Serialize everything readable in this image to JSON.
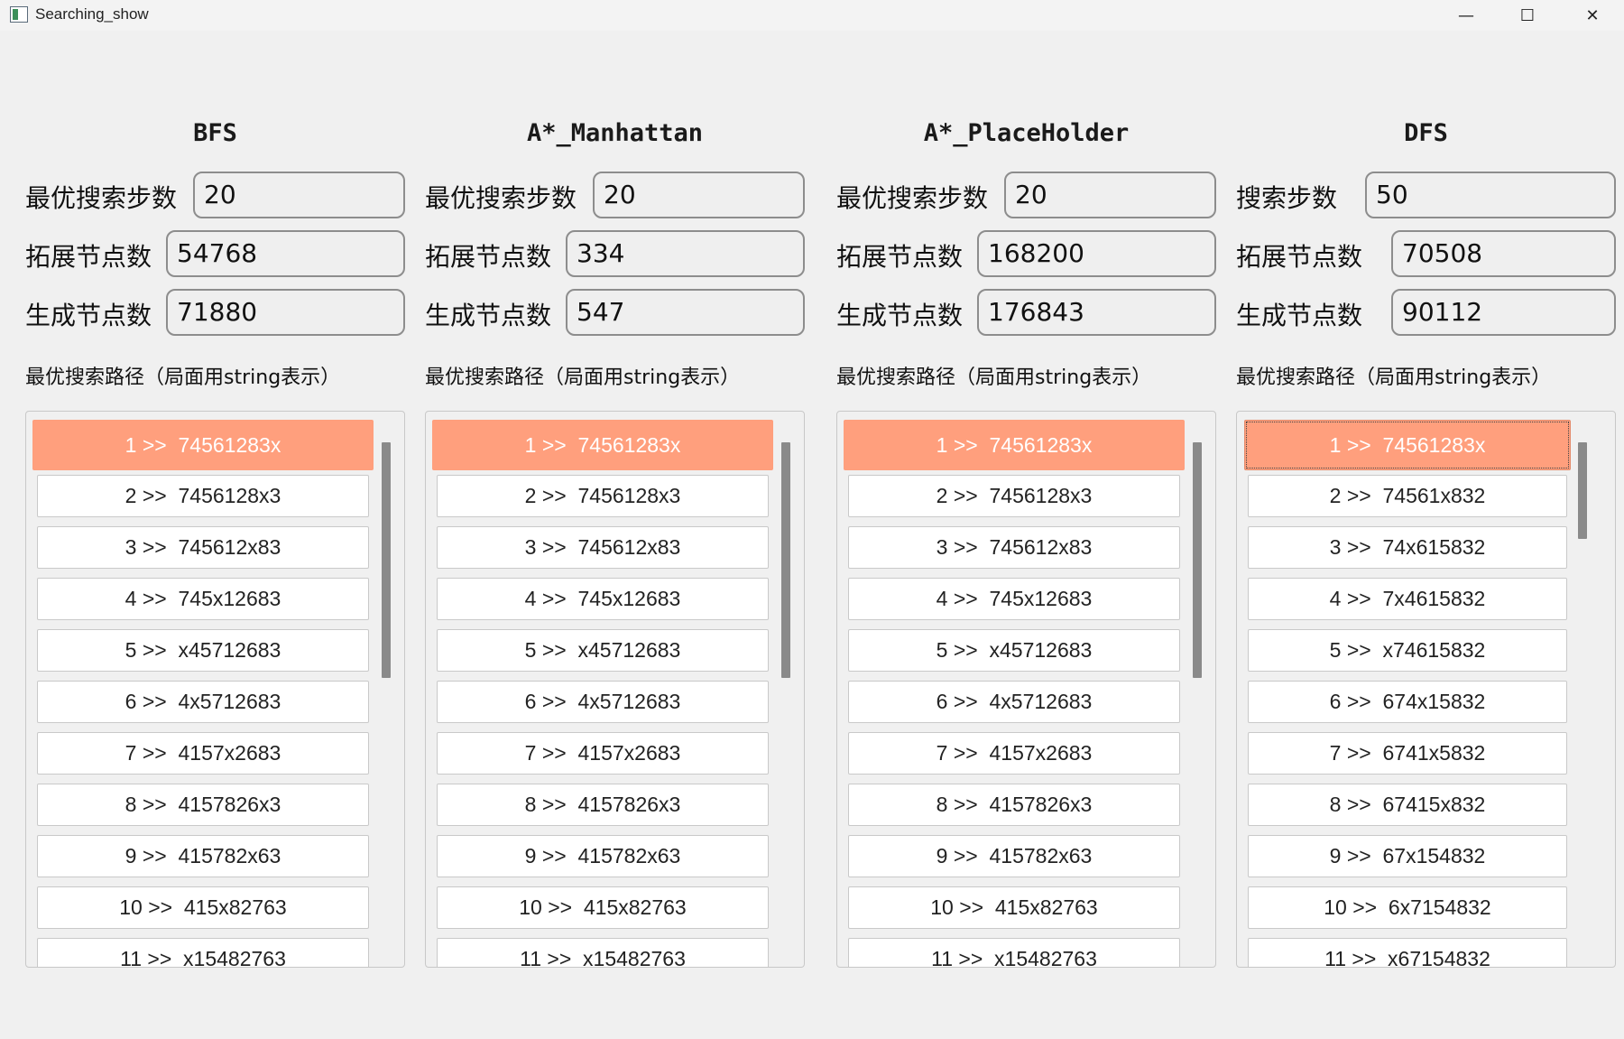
{
  "window": {
    "title": "Searching_show",
    "minimize_glyph": "—",
    "maximize_glyph": "☐",
    "close_glyph": "✕"
  },
  "path_caption": "最优搜索路径（局面用string表示）",
  "colors": {
    "selected": "#ff9f7d",
    "scrollbar": "#8a8a8a",
    "background": "#f0f0f0"
  },
  "columns": [
    {
      "title": "BFS",
      "steps_label": "最优搜索步数",
      "steps": "20",
      "expanded_label": "拓展节点数",
      "expanded": "54768",
      "generated_label": "生成节点数",
      "generated": "71880",
      "items": [
        "1 >>  74561283x",
        "2 >>  7456128x3",
        "3 >>  745612x83",
        "4 >>  745x12683",
        "5 >>  x45712683",
        "6 >>  4x5712683",
        "7 >>  4157x2683",
        "8 >>  4157826x3",
        "9 >>  415782x63",
        "10 >>  415x82763",
        "11 >>  x15482763"
      ]
    },
    {
      "title": "A*_Manhattan",
      "steps_label": "最优搜索步数",
      "steps": "20",
      "expanded_label": "拓展节点数",
      "expanded": "334",
      "generated_label": "生成节点数",
      "generated": "547",
      "items": [
        "1 >>  74561283x",
        "2 >>  7456128x3",
        "3 >>  745612x83",
        "4 >>  745x12683",
        "5 >>  x45712683",
        "6 >>  4x5712683",
        "7 >>  4157x2683",
        "8 >>  4157826x3",
        "9 >>  415782x63",
        "10 >>  415x82763",
        "11 >>  x15482763"
      ]
    },
    {
      "title": "A*_PlaceHolder",
      "steps_label": "最优搜索步数",
      "steps": "20",
      "expanded_label": "拓展节点数",
      "expanded": "168200",
      "generated_label": "生成节点数",
      "generated": "176843",
      "items": [
        "1 >>  74561283x",
        "2 >>  7456128x3",
        "3 >>  745612x83",
        "4 >>  745x12683",
        "5 >>  x45712683",
        "6 >>  4x5712683",
        "7 >>  4157x2683",
        "8 >>  4157826x3",
        "9 >>  415782x63",
        "10 >>  415x82763",
        "11 >>  x15482763"
      ]
    },
    {
      "title": "DFS",
      "steps_label": "搜索步数",
      "steps": "50",
      "expanded_label": "拓展节点数",
      "expanded": "70508",
      "generated_label": "生成节点数",
      "generated": "90112",
      "items": [
        "1 >>  74561283x",
        "2 >>  74561x832",
        "3 >>  74x615832",
        "4 >>  7x4615832",
        "5 >>  x74615832",
        "6 >>  674x15832",
        "7 >>  6741x5832",
        "8 >>  67415x832",
        "9 >>  67x154832",
        "10 >>  6x7154832",
        "11 >>  x67154832"
      ]
    }
  ]
}
